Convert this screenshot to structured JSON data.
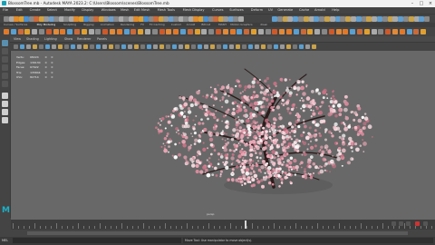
{
  "window": {
    "title": "BlossomTree.mb - Autodesk MAYA 2023.2: C:\\Users\\Blossom\\scenes\\BlossomTree.mb"
  },
  "menus": [
    "File",
    "Edit",
    "Create",
    "Select",
    "Modify",
    "Display",
    "Windows",
    "Mesh",
    "Edit Mesh",
    "Mesh Tools",
    "Mesh Display",
    "Curves",
    "Surfaces",
    "Deform",
    "UV",
    "Generate",
    "Cache",
    "Arnold",
    "Help"
  ],
  "workspace": {
    "label": "Maya Classic"
  },
  "shelf_tabs": [
    "Curves / Surfaces",
    "Poly Modeling",
    "Sculpting",
    "Rigging",
    "Animation",
    "Rendering",
    "FX",
    "FX Caching",
    "Custom",
    "Arnold",
    "Bifrost",
    "MASH",
    "Motion Graphics",
    "XGen"
  ],
  "panel_menu": [
    "View",
    "Shading",
    "Lighting",
    "Show",
    "Renderer",
    "Panels"
  ],
  "hud": {
    "rows": [
      [
        "Verts:",
        "68224",
        "0",
        "0"
      ],
      [
        "Edges:",
        "136130",
        "0",
        "0"
      ],
      [
        "Faces:",
        "67922",
        "0",
        "0"
      ],
      [
        "Tris:",
        "135844",
        "0",
        "0"
      ],
      [
        "UVs:",
        "82714",
        "0",
        "0"
      ]
    ]
  },
  "camera_label": "persp",
  "command_line": {
    "label": "MEL",
    "help": "Move Tool: Use manipulator to move object(s)."
  },
  "brand_color": "#1ab2c8",
  "icons": [
    "maya-logo-icon",
    "select-tool-icon",
    "lasso-tool-icon",
    "paint-tool-icon",
    "move-tool-icon",
    "rotate-tool-icon",
    "scale-tool-icon",
    "play-forward-icon",
    "play-back-icon"
  ]
}
